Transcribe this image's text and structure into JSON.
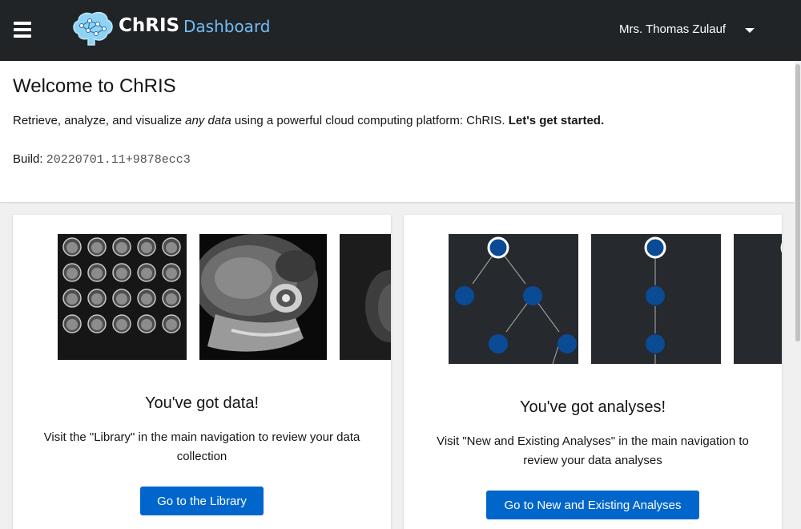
{
  "header": {
    "brand_name": "ChRIS",
    "brand_suffix": "Dashboard",
    "user_name": "Mrs. Thomas Zulauf"
  },
  "welcome": {
    "title": "Welcome to ChRIS",
    "intro_prefix": "Retrieve, analyze, and visualize ",
    "intro_emphasis": "any data",
    "intro_suffix": " using a powerful cloud computing platform: ChRIS. ",
    "intro_strong": "Let's get started.",
    "build_label": "Build: ",
    "build_value": "20220701.11+9878ecc3"
  },
  "cards": {
    "data": {
      "title": "You've got data!",
      "description": "Visit the \"Library\" in the main navigation to review your data collection",
      "button_label": "Go to the Library"
    },
    "analyses": {
      "title": "You've got analyses!",
      "description": "Visit \"New and Existing Analyses\" in the main navigation to review your data analyses",
      "button_label": "Go to New and Existing Analyses"
    }
  },
  "colors": {
    "topbar": "#212427",
    "accent_blue": "#0066cc",
    "brand_light_blue": "#73bcf7",
    "node_blue": "#0b4a94",
    "graph_bg": "#26292d"
  },
  "icons": {
    "menu": "hamburger-icon",
    "logo": "brain-network-logo",
    "user_menu": "caret-down-icon"
  }
}
